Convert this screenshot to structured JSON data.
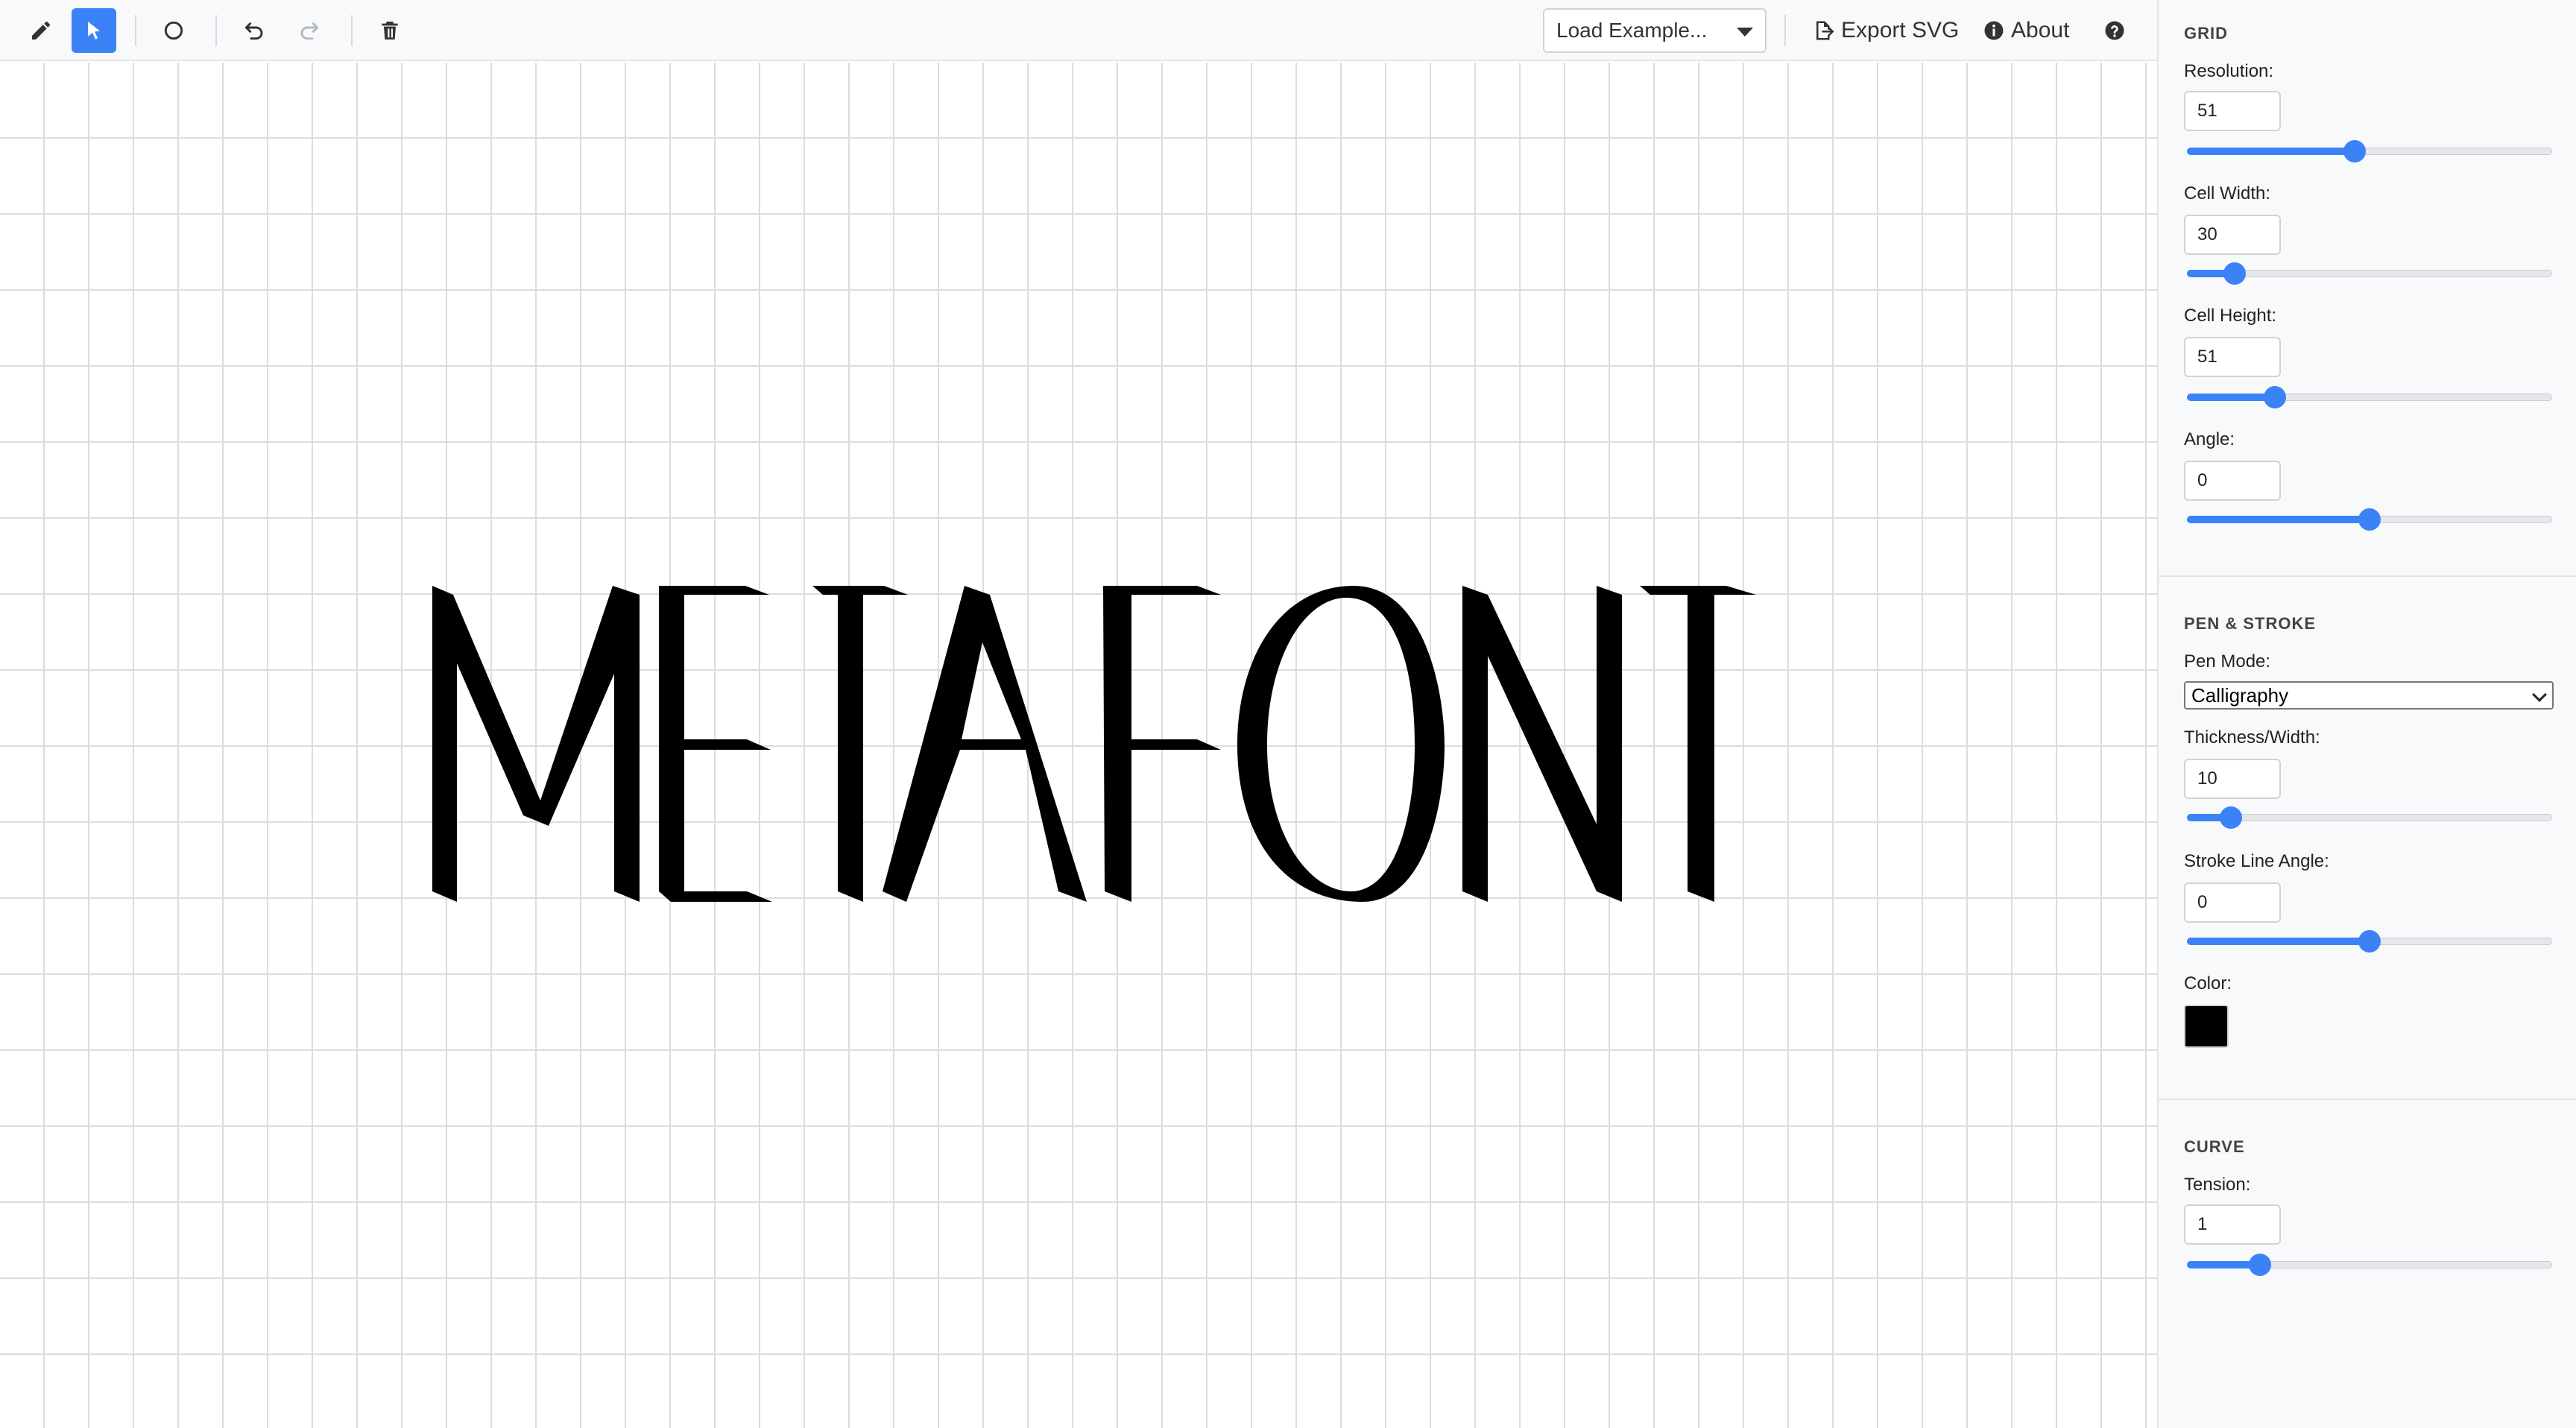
{
  "toolbar": {
    "tools": [
      {
        "name": "draw",
        "icon": "pencil-icon"
      },
      {
        "name": "select",
        "icon": "pointer-icon",
        "active": true
      },
      {
        "name": "circle",
        "icon": "circle-icon"
      },
      {
        "name": "undo",
        "icon": "undo-icon"
      },
      {
        "name": "redo",
        "icon": "redo-icon"
      },
      {
        "name": "delete",
        "icon": "trash-icon"
      }
    ],
    "example_select": "Load Example...",
    "export_label": "Export SVG",
    "about_label": "About",
    "accent_color": "#3b82f6"
  },
  "canvas": {
    "text": "METAFONT",
    "stroke_color": "#000000",
    "grid_color": "#dcdcdc"
  },
  "panel": {
    "grid": {
      "title": "GRID",
      "resolution": {
        "label": "Resolution:",
        "value": "51",
        "fraction": 0.46
      },
      "cell_width": {
        "label": "Cell Width:",
        "value": "30",
        "fraction": 0.13
      },
      "cell_height": {
        "label": "Cell Height:",
        "value": "51",
        "fraction": 0.24
      },
      "angle": {
        "label": "Angle:",
        "value": "0",
        "fraction": 0.5
      }
    },
    "pen": {
      "title": "PEN & STROKE",
      "mode": {
        "label": "Pen Mode:",
        "value": "Calligraphy"
      },
      "thickness": {
        "label": "Thickness/Width:",
        "value": "10",
        "fraction": 0.12
      },
      "stroke_angle": {
        "label": "Stroke Line Angle:",
        "value": "0",
        "fraction": 0.5
      },
      "color": {
        "label": "Color:",
        "value": "#000000"
      }
    },
    "curve": {
      "title": "CURVE",
      "tension": {
        "label": "Tension:",
        "value": "1",
        "fraction": 0.2
      }
    }
  }
}
